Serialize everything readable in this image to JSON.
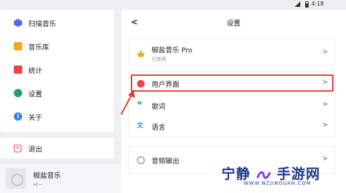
{
  "status": {
    "time": "4:18"
  },
  "sidebar": {
    "items": [
      {
        "label": "扫描音乐",
        "icon": "scan-icon"
      },
      {
        "label": "音乐库",
        "icon": "library-icon"
      },
      {
        "label": "统计",
        "icon": "chart-icon"
      },
      {
        "label": "设置",
        "icon": "gear-icon"
      },
      {
        "label": "关于",
        "icon": "info-icon"
      }
    ],
    "logout": {
      "label": "退出",
      "icon": "exit-icon"
    }
  },
  "player": {
    "title": "椒盐音乐",
    "subtitle": "Hi~"
  },
  "settings": {
    "back_icon": "<",
    "title": "设置",
    "pro": {
      "label": "椒盐音乐 Pro",
      "status": "已禁用",
      "icon": "crown-icon"
    },
    "items": [
      {
        "label": "用户界面",
        "icon": "palette-icon"
      },
      {
        "label": "歌词",
        "icon": "quote-icon"
      },
      {
        "label": "语言",
        "icon": "translate-icon"
      }
    ],
    "audio": {
      "label": "音频输出",
      "icon": "audio-icon"
    },
    "chevron": ">"
  },
  "annotation": {
    "highlight_color": "#e53935"
  },
  "watermark": {
    "main": "宁静",
    "main2": "手游网",
    "sub": "WWW.NZJINGUAN.COM"
  }
}
